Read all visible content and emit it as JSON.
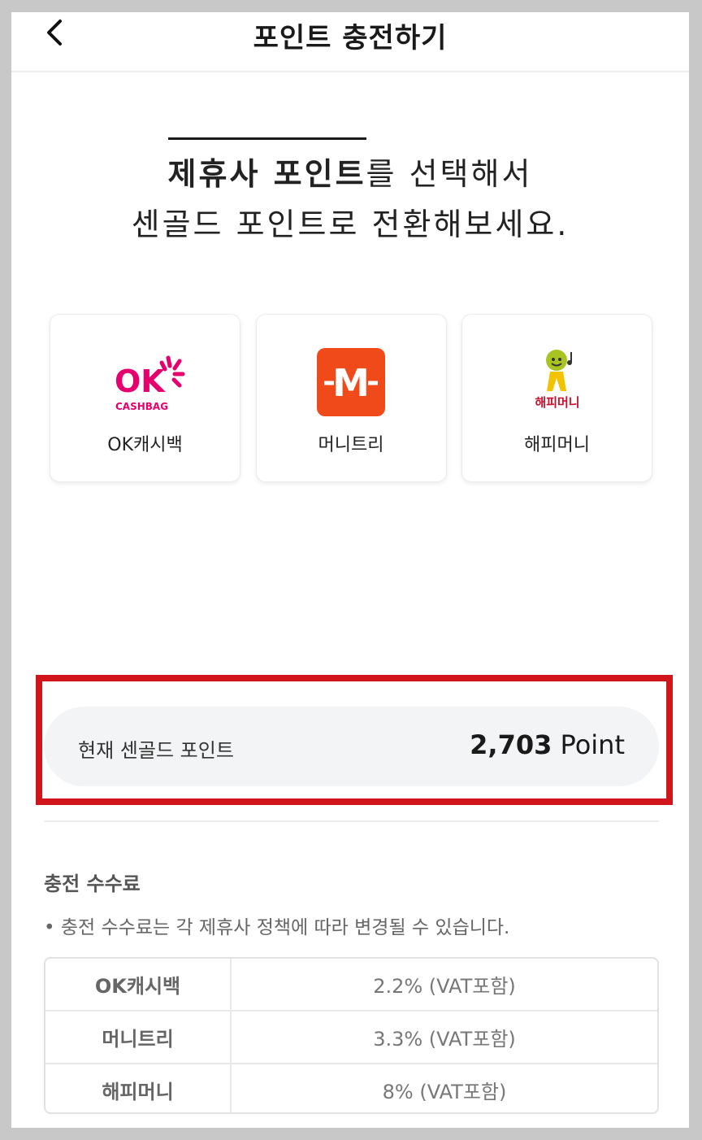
{
  "header": {
    "title": "포인트 충전하기"
  },
  "headline": {
    "emphasis": "제휴사 포인트",
    "line1_rest": "를 선택해서",
    "line2": "센골드 포인트로 전환해보세요."
  },
  "partners": [
    {
      "name": "OK캐시백",
      "logo_text": "OK",
      "logo_sub": "CASHBAG",
      "color": "#e6006e"
    },
    {
      "name": "머니트리",
      "logo_text": "M",
      "color": "#f04a1a"
    },
    {
      "name": "해피머니",
      "logo_text": "해피머니",
      "color": "#c8102e"
    }
  ],
  "points": {
    "label": "현재 센골드 포인트",
    "value": "2,703",
    "unit": "Point"
  },
  "fees": {
    "title": "충전 수수료",
    "note": "• 충전 수수료는 각 제휴사 정책에 따라 변경될 수 있습니다.",
    "rows": [
      {
        "name": "OK캐시백",
        "rate": "2.2% (VAT포함)"
      },
      {
        "name": "머니트리",
        "rate": "3.3% (VAT포함)"
      },
      {
        "name": "해피머니",
        "rate": "8% (VAT포함)"
      }
    ]
  },
  "colors": {
    "highlight": "#d0161b",
    "pill_bg": "#f3f4f6"
  }
}
